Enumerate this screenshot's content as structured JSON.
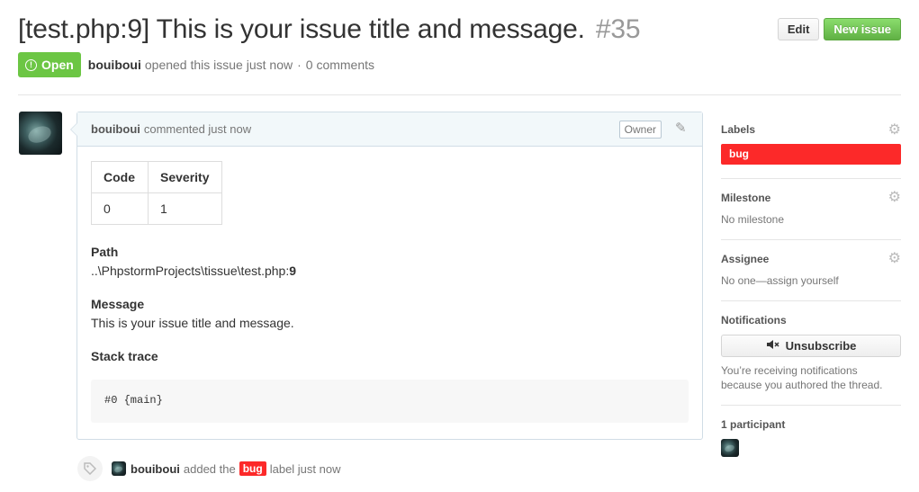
{
  "issue": {
    "title": "[test.php:9] This is your issue title and message.",
    "number": "#35",
    "state": "Open",
    "author": "bouiboui",
    "opened_text": "opened this issue just now",
    "separator": "·",
    "comments_count": "0 comments"
  },
  "header": {
    "edit_label": "Edit",
    "new_issue_label": "New issue"
  },
  "comment": {
    "author": "bouiboui",
    "time_text": "commented just now",
    "owner_badge": "Owner",
    "table": {
      "headers": [
        "Code",
        "Severity"
      ],
      "rows": [
        [
          "0",
          "1"
        ]
      ]
    },
    "path_heading": "Path",
    "path_prefix": "..\\PhpstormProjects\\tissue\\test.php:",
    "path_line": "9",
    "message_heading": "Message",
    "message_text": "This is your issue title and message.",
    "stack_heading": "Stack trace",
    "stack_code": "#0 {main}"
  },
  "timeline": {
    "author": "bouiboui",
    "action_pre": "added the",
    "label": "bug",
    "action_post": "label just now"
  },
  "sidebar": {
    "labels_heading": "Labels",
    "label_name": "bug",
    "label_color": "#fc2929",
    "milestone_heading": "Milestone",
    "milestone_value": "No milestone",
    "assignee_heading": "Assignee",
    "assignee_value": "No one—assign yourself",
    "notifications_heading": "Notifications",
    "unsubscribe_label": "Unsubscribe",
    "notifications_note": "You’re receiving notifications because you authored the thread.",
    "participants_heading": "1 participant"
  },
  "icons": {
    "open_state": "issue-opened-icon",
    "pencil": "pencil-icon",
    "gear": "gear-icon",
    "tag": "tag-icon",
    "mute": "mute-icon"
  },
  "colors": {
    "open_green": "#6cc644",
    "new_issue_green": "#60b044",
    "bug_red": "#fc2929"
  }
}
